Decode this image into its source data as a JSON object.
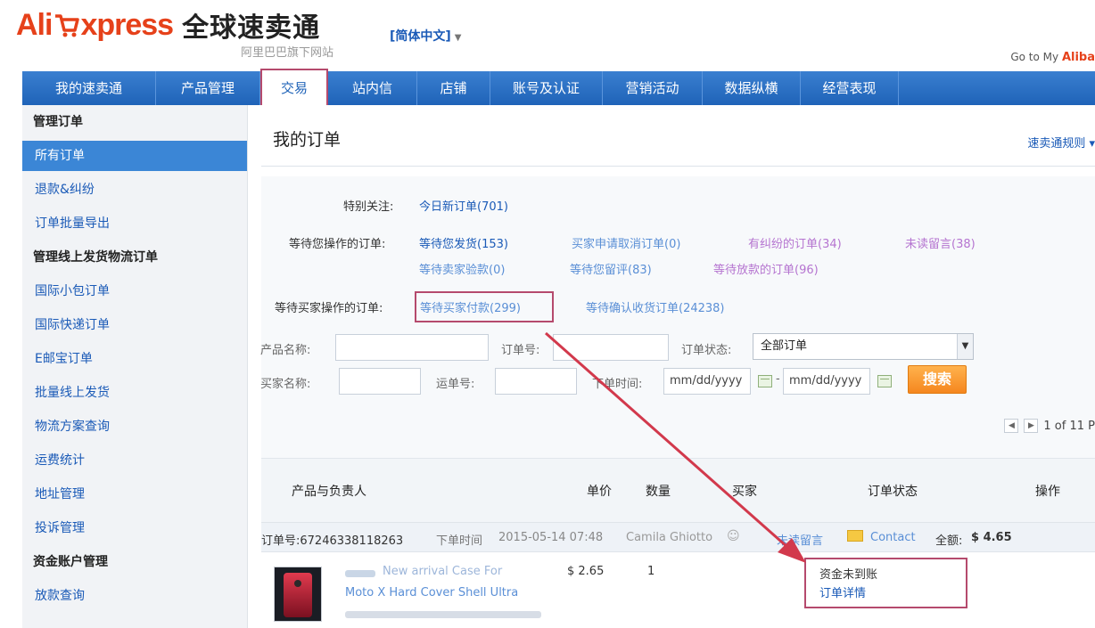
{
  "header": {
    "logo_ali": "Ali",
    "logo_xpress": "xpress",
    "logo_cn": "全球速卖通",
    "logo_sub": "阿里巴巴旗下网站",
    "lang": "[简体中文]",
    "goto_text": "Go to My",
    "goto_brand": "Aliba"
  },
  "nav": {
    "items": [
      {
        "label": "我的速卖通"
      },
      {
        "label": "产品管理"
      },
      {
        "label": "交易"
      },
      {
        "label": "站内信"
      },
      {
        "label": "店铺"
      },
      {
        "label": "账号及认证"
      },
      {
        "label": "营销活动"
      },
      {
        "label": "数据纵横"
      },
      {
        "label": "经营表现"
      }
    ]
  },
  "sidebar": {
    "section1": "管理订单",
    "items1": [
      "所有订单",
      "退款&纠纷",
      "订单批量导出"
    ],
    "section2": "管理线上发货物流订单",
    "items2": [
      "国际小包订单",
      "国际快递订单",
      "E邮宝订单",
      "批量线上发货",
      "物流方案查询",
      "运费统计",
      "地址管理",
      "投诉管理"
    ],
    "section3": "资金账户管理",
    "items3": [
      "放款查询"
    ]
  },
  "main": {
    "title": "我的订单",
    "rules_link": "速卖通规则",
    "special_label": "特别关注:",
    "special_link": "今日新订单(701)",
    "you_label": "等待您操作的订单:",
    "you_links": [
      "等待您发货(153)",
      "买家申请取消订单(0)",
      "有纠纷的订单(34)",
      "未读留言(38)",
      "等待卖家验款(0)",
      "等待您留评(83)",
      "等待放款的订单(96)"
    ],
    "buyer_label": "等待买家操作的订单:",
    "buyer_links": [
      "等待买家付款(299)",
      "等待确认收货订单(24238)"
    ]
  },
  "search": {
    "product_label": "产品名称:",
    "order_no_label": "订单号:",
    "status_label": "订单状态:",
    "status_value": "全部订单",
    "buyer_label": "买家名称:",
    "tracking_label": "运单号:",
    "time_label": "下单时间:",
    "date_placeholder": "mm/dd/yyyy",
    "date_sep": "-",
    "search_button": "搜索"
  },
  "pager": {
    "text": "1 of 11 P"
  },
  "table": {
    "headers": [
      "产品与负责人",
      "单价",
      "数量",
      "买家",
      "订单状态",
      "操作"
    ]
  },
  "order": {
    "order_no": "订单号:67246338118263",
    "time_label": "下单时间",
    "time_value": "2015-05-14 07:48",
    "buyer": "Camila Ghiotto",
    "unread": "未读留言",
    "contact": "Contact",
    "total_label": "全额:",
    "total_value": "$ 4.65",
    "product_line1": "New arrival Case For",
    "product_line2": "Moto X Hard Cover Shell Ultra",
    "price": "$ 2.65",
    "qty": "1",
    "status": "资金未到账",
    "detail_link": "订单详情"
  },
  "colors": {
    "brand": "#e6411a",
    "nav": "#2b6fc4",
    "link": "#1a5ab7",
    "highlight": "#b54a6d",
    "search_button": "#f5871f"
  }
}
